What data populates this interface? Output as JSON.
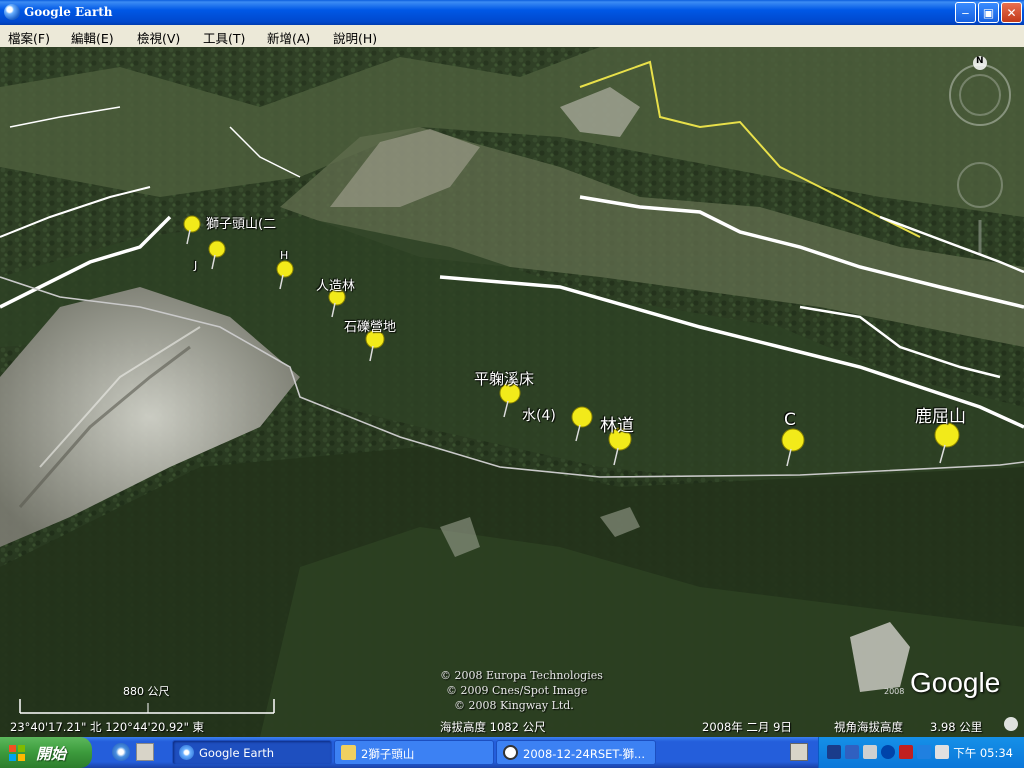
{
  "window": {
    "title": "Google Earth",
    "min_symbol": "‒",
    "max_symbol": "▣",
    "close_symbol": "✕"
  },
  "menu": [
    "檔案(F)",
    "編輯(E)",
    "檢視(V)",
    "工具(T)",
    "新增(A)",
    "說明(H)"
  ],
  "compass": {
    "north_label": "N"
  },
  "placemarks": [
    {
      "label": "獅子頭山(二"
    },
    {
      "label": "J"
    },
    {
      "label": "H"
    },
    {
      "label": "人造林"
    },
    {
      "label": "石礫營地"
    },
    {
      "label": "平躹溪床"
    },
    {
      "label": "水(4)"
    },
    {
      "label": "林道"
    },
    {
      "label": ""
    },
    {
      "label": "C"
    },
    {
      "label": "鹿屈山"
    }
  ],
  "copyright": [
    "© 2008 Europa Technologies",
    "© 2009 Cnes/Spot Image",
    "© 2008 Kingway Ltd."
  ],
  "scale_bar": {
    "label": "880 公尺"
  },
  "status_bar": {
    "coordinates": "23°40'17.21\" 北   120°44'20.92\" 東",
    "elevation": "海拔高度  1082 公尺",
    "imagery_date": "2008年 二月  9日",
    "eye_altitude_label": "視角海拔高度",
    "eye_altitude_value": "3.98 公里"
  },
  "logo": {
    "text": "Google",
    "year": "2008"
  },
  "taskbar": {
    "start_label": "開始",
    "tasks": [
      {
        "label": "Google Earth",
        "icon": "google-earth-icon",
        "active": true
      },
      {
        "label": "2獅子頭山",
        "icon": "folder-icon",
        "active": false
      },
      {
        "label": "2008-12-24RSET-獅...",
        "icon": "browser-icon",
        "active": false
      }
    ],
    "clock": "下午 05:34"
  },
  "colors": {
    "pin": "#f2ea1a",
    "trail": "#ffffff",
    "road": "#e8e04a",
    "taskbar": "#245edb",
    "start": "#3c9a3c"
  }
}
